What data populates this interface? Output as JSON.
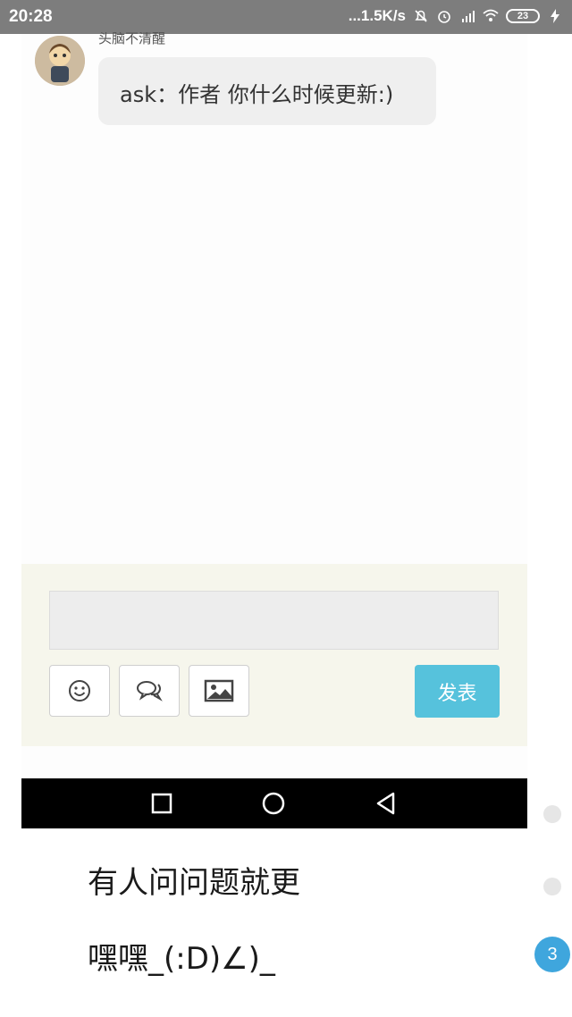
{
  "status_bar": {
    "time": "20:28",
    "network_speed": "...1.5K/s",
    "battery_level": "23",
    "icons": [
      "mute-bell-icon",
      "alarm-icon",
      "signal-hd-icon",
      "wifi-icon",
      "battery-icon",
      "charging-icon"
    ]
  },
  "post": {
    "username": "头脑不清醒",
    "message": "ask：作者 你什么时候更新:)"
  },
  "composer": {
    "input_value": "",
    "tools": [
      "emoji-icon",
      "chat-bubbles-icon",
      "image-icon"
    ],
    "post_label": "发表"
  },
  "nav_bar": {
    "buttons": [
      "recent-apps-icon",
      "home-icon",
      "back-icon"
    ]
  },
  "article": {
    "line1": "有人问问题就更",
    "line2": "嘿嘿_(:D)∠)_"
  },
  "side": {
    "badge_count": "3"
  },
  "colors": {
    "status_bar": "#7d7d7d",
    "accent": "#56c2dc",
    "badge": "#3fa6dd",
    "composer_bg": "#f6f6ec"
  }
}
